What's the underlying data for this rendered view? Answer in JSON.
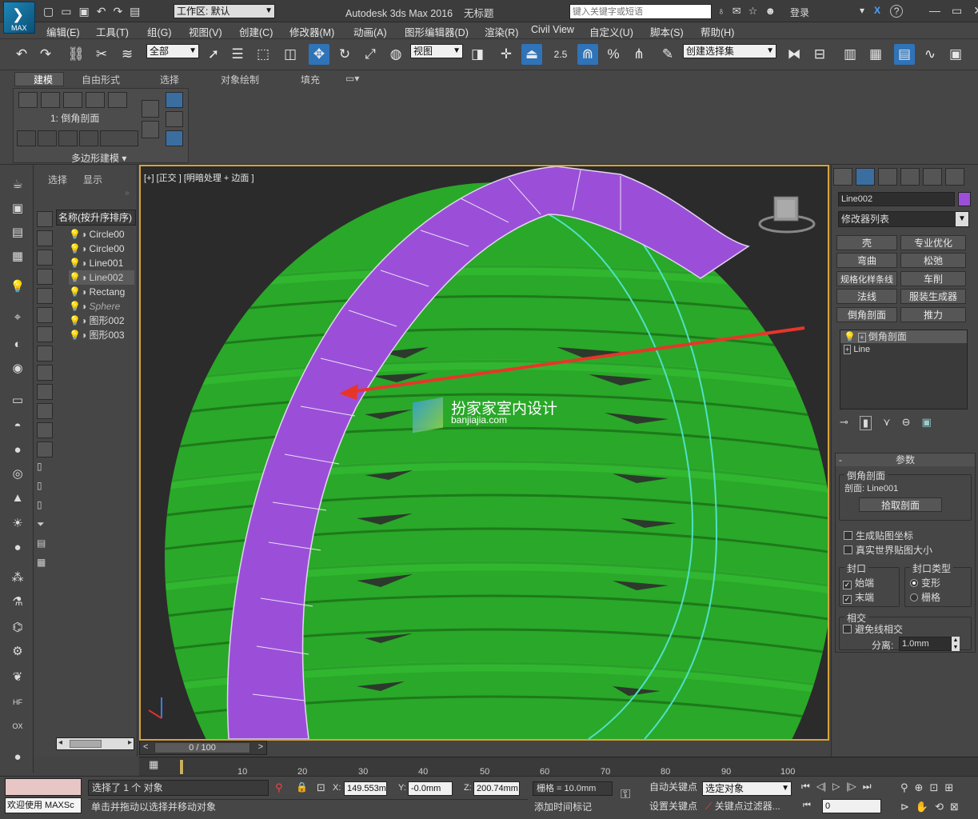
{
  "app": {
    "title": "Autodesk 3ds Max 2016",
    "doc": "无标题",
    "workspace": "工作区: 默认",
    "search_placeholder": "键入关键字或短语",
    "login": "登录",
    "help": "?",
    "logo_text": "MAX"
  },
  "menu": [
    "编辑(E)",
    "工具(T)",
    "组(G)",
    "视图(V)",
    "创建(C)",
    "修改器(M)",
    "动画(A)",
    "图形编辑器(D)",
    "渲染(R)",
    "Civil View",
    "自定义(U)",
    "脚本(S)",
    "帮助(H)"
  ],
  "toolbar": {
    "filter_select": "全部",
    "ref_coord": "视图",
    "snap_value": "2.5",
    "named_sel": "创建选择集"
  },
  "ribbon": {
    "tabs": [
      "建模",
      "自由形式",
      "选择",
      "对象绘制",
      "填充"
    ],
    "modifier_label": "1: 倒角剖面",
    "polygon_modeling": "多边形建模"
  },
  "scene_explorer": {
    "tab_select": "选择",
    "tab_display": "显示",
    "header": "名称(按升序排序)",
    "items": [
      "Circle00",
      "Circle00",
      "Line001",
      "Line002",
      "Rectang",
      "Sphere",
      "图形002",
      "图形003"
    ]
  },
  "viewport": {
    "label": "[+] [正交 ] [明暗处理 + 边面 ]",
    "watermark_title": "扮家家室内设计",
    "watermark_url": "banjiajia.com"
  },
  "cmd_panel": {
    "object_name": "Line002",
    "object_color": "#9b4fd8",
    "modifier_list": "修改器列表",
    "buttons": [
      "壳",
      "专业优化",
      "弯曲",
      "松弛",
      "规格化样条线",
      "车削",
      "法线",
      "服装生成器",
      "倒角剖面",
      "推力"
    ],
    "stack": [
      "倒角剖面",
      "Line"
    ],
    "params_title": "参数",
    "bevel_profile_group": "倒角剖面",
    "profile_label": "剖面:",
    "profile_value": "Line001",
    "pick_profile": "拾取剖面",
    "gen_map": "生成贴图坐标",
    "real_world": "真实世界贴图大小",
    "cap_title": "封口",
    "cap_start": "始端",
    "cap_end": "末端",
    "cap_type_title": "封口类型",
    "cap_morph": "变形",
    "cap_grid": "栅格",
    "intersect_title": "相交",
    "avoid_line": "避免线相交",
    "separation_label": "分离:",
    "separation_value": "1.0mm"
  },
  "timeline": {
    "frame": "0 / 100",
    "ticks": [
      "10",
      "20",
      "30",
      "40",
      "50",
      "60",
      "70",
      "80",
      "90",
      "100"
    ]
  },
  "status": {
    "welcome": "欢迎使用 MAXSc",
    "selected": "选择了 1 个 对象",
    "hint": "单击并拖动以选择并移动对象",
    "x_label": "X:",
    "x": "149.553m",
    "y_label": "Y:",
    "y": "-0.0mm",
    "z_label": "Z:",
    "z": "200.74mm",
    "grid": "栅格 = 10.0mm",
    "add_tag": "添加时间标记",
    "auto_key": "自动关键点",
    "set_key": "设置关键点",
    "sel_obj": "选定对象",
    "key_filter": "关键点过滤器...",
    "frame_val": "0"
  }
}
